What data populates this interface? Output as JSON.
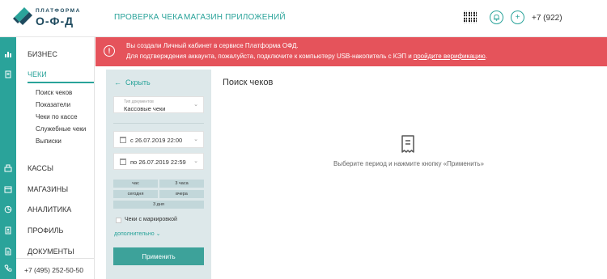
{
  "header": {
    "logo_top": "ПЛАТФОРМА",
    "logo_main": "О-Ф-Д",
    "nav": [
      "ПРОВЕРКА ЧЕКА",
      "МАГАЗИН ПРИЛОЖЕНИЙ"
    ],
    "phone": "+7 (922)"
  },
  "sidebar": {
    "items": [
      {
        "label": "БИЗНЕС",
        "icon": "bar-chart-icon"
      },
      {
        "label": "ЧЕКИ",
        "icon": "receipt-icon"
      },
      {
        "label": "КАССЫ",
        "icon": "cash-register-icon"
      },
      {
        "label": "МАГАЗИНЫ",
        "icon": "store-icon"
      },
      {
        "label": "АНАЛИТИКА",
        "icon": "pie-chart-icon"
      },
      {
        "label": "ПРОФИЛЬ",
        "icon": "id-card-icon"
      },
      {
        "label": "ДОКУМЕНТЫ",
        "icon": "document-icon"
      }
    ],
    "sub_items": [
      "Поиск чеков",
      "Показатели",
      "Чеки по кассе",
      "Служебные чеки",
      "Выписки"
    ],
    "phone": "+7 (495) 252-50-50"
  },
  "alert": {
    "line1": "Вы создали Личный кабинет в сервисе Платформа ОФД.",
    "line2_prefix": "Для подтверждения аккаунта, пожалуйста, подключите к компьютеру USB-накопитель с КЭП и ",
    "line2_link": "пройдите верификацию",
    "line2_suffix": "."
  },
  "filter": {
    "hide_label": "Скрыть",
    "doc_type_caption": "Тип документов",
    "doc_type_value": "Кассовые чеки",
    "date_from": "с  26.07.2019 22:00",
    "date_to": "по  26.07.2019 22:59",
    "quick": [
      "час",
      "3 часа",
      "сегодня",
      "вчера",
      "3 дня"
    ],
    "checkbox_label": "Чеки с маркировкой",
    "more_label": "дополнительно",
    "apply_label": "Применить"
  },
  "main": {
    "title": "Поиск чеков",
    "empty_text": "Выберите период и нажмите кнопку «Применить»"
  },
  "colors": {
    "accent": "#2aa39a",
    "alert": "#e5535b",
    "panel": "#dde8ea"
  }
}
